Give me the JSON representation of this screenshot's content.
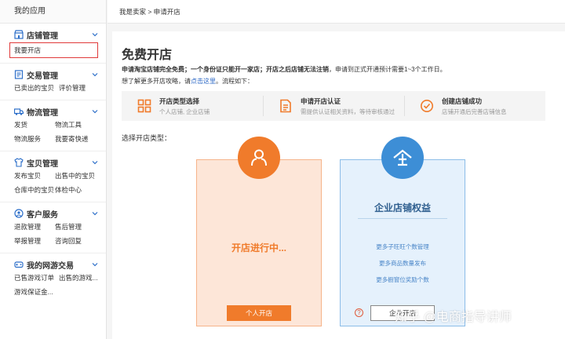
{
  "sidebar": {
    "header": "我的应用",
    "groups": [
      {
        "title": "店铺管理",
        "icon": "shop-icon",
        "items": [
          "我要开店"
        ]
      },
      {
        "title": "交易管理",
        "icon": "trade-icon",
        "items": [
          "已卖出的宝贝",
          "评价管理"
        ]
      },
      {
        "title": "物流管理",
        "icon": "truck-icon",
        "items": [
          "发货",
          "物流工具",
          "物流服务",
          "我要寄快递"
        ]
      },
      {
        "title": "宝贝管理",
        "icon": "shirt-icon",
        "items": [
          "发布宝贝",
          "出售中的宝贝",
          "仓库中的宝贝",
          "体检中心"
        ]
      },
      {
        "title": "客户服务",
        "icon": "customer-icon",
        "items": [
          "退款管理",
          "售后管理",
          "举报管理",
          "咨询回复"
        ]
      },
      {
        "title": "我的网游交易",
        "icon": "game-icon",
        "items": [
          "已售游戏订单",
          "出售的游戏...",
          "游戏保证金..."
        ]
      }
    ]
  },
  "breadcrumb": "我是卖家 > 申请开店",
  "main": {
    "title": "免费开店",
    "desc_bold": "申请淘宝店铺完全免费；一个身份证只能开一家店；开店之后店铺无法注销",
    "desc_rest": "，申请到正式开通预计需要1~3个工作日。",
    "desc2_pre": "想了解更多开店攻略，请",
    "desc2_link": "点击这里",
    "desc2_post": "。流程如下：",
    "steps": [
      {
        "title": "开店类型选择",
        "sub": "个人店铺, 企业店铺",
        "icon": "grid-icon"
      },
      {
        "title": "申请开店认证",
        "sub": "需提供认证相关资料，等待审核通过",
        "icon": "document-icon"
      },
      {
        "title": "创建店铺成功",
        "sub": "店铺开通后完善店铺信息",
        "icon": "check-circle-icon"
      }
    ],
    "choose_label": "选择开店类型：",
    "personal": {
      "status": "开店进行中...",
      "button": "个人开店"
    },
    "company": {
      "title": "企业店铺权益",
      "benefits": [
        "更多子旺旺个数管理",
        "更多商品数量发布",
        "更多橱窗位奖励个数"
      ],
      "button": "企业开店",
      "help": "?"
    }
  },
  "watermark": "知乎 @电商指导讲师",
  "colors": {
    "accent": "#f07b2b",
    "blue": "#3d8ed6",
    "highlight": "#e03a3a"
  }
}
